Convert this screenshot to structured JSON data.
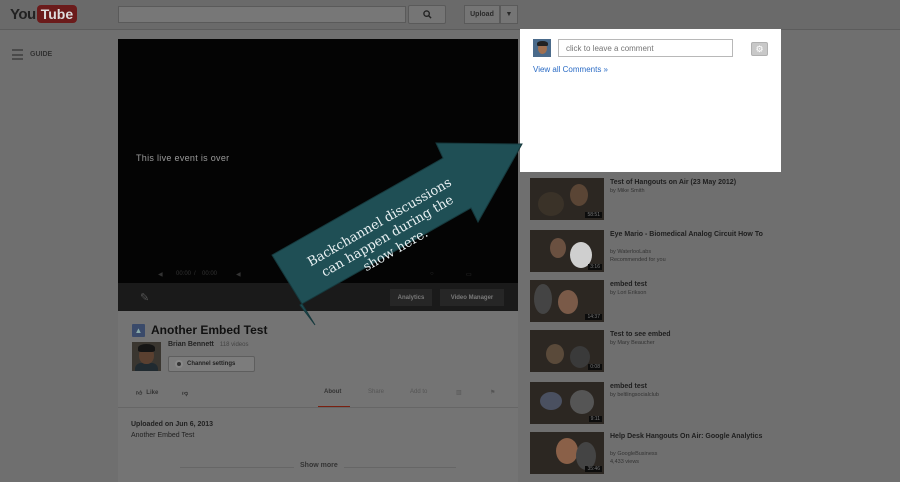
{
  "masthead": {
    "logo_you": "You",
    "logo_tube": "Tube",
    "upload_label": "Upload"
  },
  "guide": {
    "label": "GUIDE"
  },
  "player": {
    "message": "This live event is over",
    "time": "00:00",
    "time_sep": "/",
    "analytics_label": "Analytics",
    "video_manager_label": "Video Manager"
  },
  "video": {
    "title": "Another Embed Test",
    "channel_name": "Brian Bennett",
    "video_count": "118 videos",
    "channel_settings_label": "Channel settings",
    "like_label": "Like",
    "tabs": {
      "about": "About",
      "share": "Share",
      "add_to": "Add to"
    },
    "uploaded": "Uploaded on Jun 6, 2013",
    "description": "Another Embed Test",
    "show_more": "Show more"
  },
  "comments": {
    "placeholder": "click to leave a comment",
    "view_all": "View all Comments »"
  },
  "callout": {
    "line1": "Backchannel discussions",
    "line2": "can happen during the",
    "line3": "show here.",
    "color": "#1f4f55"
  },
  "recommended": [
    {
      "title": "Test of Hangouts on Air (23 May 2012)",
      "by": "by Mike Smith",
      "extra": "",
      "duration": "58:51"
    },
    {
      "title": "Eye Mario - Biomedical Analog Circuit How To",
      "by": "by WaterlooLabs",
      "extra": "Recommended for you",
      "duration": "3:16"
    },
    {
      "title": "embed test",
      "by": "by Lori Erikson",
      "extra": "",
      "duration": "14:37"
    },
    {
      "title": "Test to see embed",
      "by": "by Mary Beaucher",
      "extra": "",
      "duration": "0:08"
    },
    {
      "title": "embed test",
      "by": "by beltlingsocialclub",
      "extra": "",
      "duration": "9:11"
    },
    {
      "title": "Help Desk Hangouts On Air: Google Analytics",
      "by": "by GoogleBusiness",
      "extra": "4,433 views",
      "duration": "35:46"
    }
  ]
}
